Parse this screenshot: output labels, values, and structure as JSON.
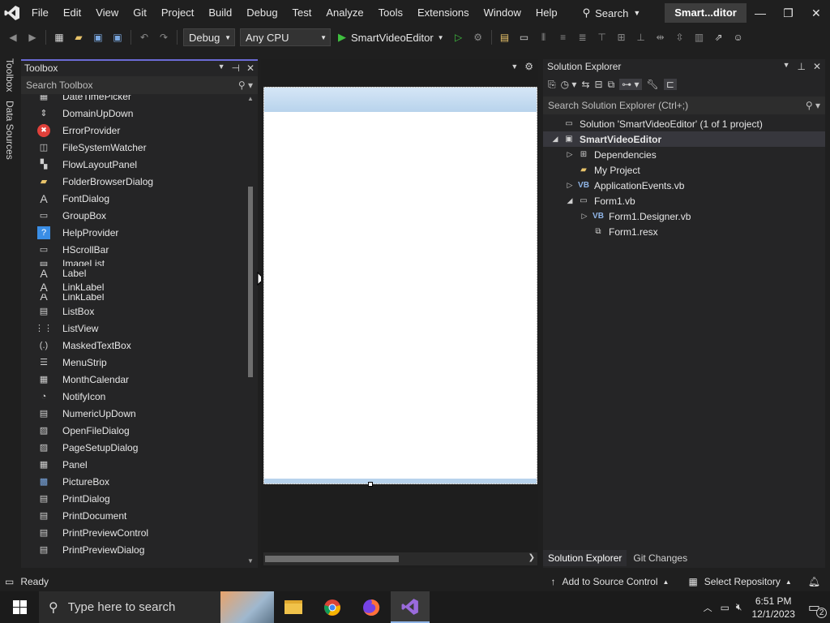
{
  "titlebar": {
    "menu": [
      "File",
      "Edit",
      "View",
      "Git",
      "Project",
      "Build",
      "Debug",
      "Test",
      "Analyze",
      "Tools",
      "Extensions",
      "Window",
      "Help"
    ],
    "search_label": "Search",
    "solution_name": "Smart...ditor"
  },
  "toolbar": {
    "config": "Debug",
    "platform": "Any CPU",
    "start_target": "SmartVideoEditor"
  },
  "left_strip": {
    "tabs": [
      "Toolbox",
      "Data Sources"
    ]
  },
  "toolbox": {
    "title": "Toolbox",
    "search_placeholder": "Search Toolbox",
    "items": [
      {
        "label": "DateTimePicker",
        "icon": "calendar-icon"
      },
      {
        "label": "DomainUpDown",
        "icon": "updown-icon"
      },
      {
        "label": "ErrorProvider",
        "icon": "error-icon"
      },
      {
        "label": "FileSystemWatcher",
        "icon": "watcher-icon"
      },
      {
        "label": "FlowLayoutPanel",
        "icon": "flowlayout-icon"
      },
      {
        "label": "FolderBrowserDialog",
        "icon": "folder-icon"
      },
      {
        "label": "FontDialog",
        "icon": "font-icon"
      },
      {
        "label": "GroupBox",
        "icon": "groupbox-icon"
      },
      {
        "label": "HelpProvider",
        "icon": "help-icon"
      },
      {
        "label": "HScrollBar",
        "icon": "hscroll-icon"
      },
      {
        "label": "ImageList",
        "icon": "imagelist-icon"
      },
      {
        "label": "Label",
        "icon": "label-icon"
      },
      {
        "label": "LinkLabel",
        "icon": "linklabel-icon"
      },
      {
        "label": "LinkLabel",
        "icon": "linklabel-icon"
      },
      {
        "label": "ListBox",
        "icon": "listbox-icon"
      },
      {
        "label": "ListView",
        "icon": "listview-icon"
      },
      {
        "label": "MaskedTextBox",
        "icon": "masked-icon"
      },
      {
        "label": "MenuStrip",
        "icon": "menustrip-icon"
      },
      {
        "label": "MonthCalendar",
        "icon": "monthcalendar-icon"
      },
      {
        "label": "NotifyIcon",
        "icon": "notify-icon"
      },
      {
        "label": "NumericUpDown",
        "icon": "numeric-icon"
      },
      {
        "label": "OpenFileDialog",
        "icon": "openfile-icon"
      },
      {
        "label": "PageSetupDialog",
        "icon": "pagesetup-icon"
      },
      {
        "label": "Panel",
        "icon": "panel-icon"
      },
      {
        "label": "PictureBox",
        "icon": "picture-icon"
      },
      {
        "label": "PrintDialog",
        "icon": "print-icon"
      },
      {
        "label": "PrintDocument",
        "icon": "printdoc-icon"
      },
      {
        "label": "PrintPreviewControl",
        "icon": "preview-icon"
      },
      {
        "label": "PrintPreviewDialog",
        "icon": "previewdialog-icon"
      }
    ]
  },
  "solution_explorer": {
    "title": "Solution Explorer",
    "search_placeholder": "Search Solution Explorer (Ctrl+;)",
    "tree": [
      {
        "label": "Solution 'SmartVideoEditor' (1 of 1 project)",
        "indent": 0,
        "arrow": "",
        "icon": "solution-icon"
      },
      {
        "label": "SmartVideoEditor",
        "indent": 0,
        "arrow": "◢",
        "icon": "vb-project-icon",
        "selected": true
      },
      {
        "label": "Dependencies",
        "indent": 1,
        "arrow": "▷",
        "icon": "dependencies-icon"
      },
      {
        "label": "My Project",
        "indent": 1,
        "arrow": "",
        "icon": "wrench-icon"
      },
      {
        "label": "ApplicationEvents.vb",
        "indent": 1,
        "arrow": "▷",
        "icon": "vb-file-icon"
      },
      {
        "label": "Form1.vb",
        "indent": 1,
        "arrow": "◢",
        "icon": "form-icon"
      },
      {
        "label": "Form1.Designer.vb",
        "indent": 2,
        "arrow": "▷",
        "icon": "vb-file-icon"
      },
      {
        "label": "Form1.resx",
        "indent": 2,
        "arrow": "",
        "icon": "resx-icon"
      }
    ],
    "tabs": [
      "Solution Explorer",
      "Git Changes"
    ]
  },
  "statusbar": {
    "status": "Ready",
    "source_control": "Add to Source Control",
    "repository": "Select Repository"
  },
  "taskbar": {
    "search_placeholder": "Type here to search",
    "time": "6:51 PM",
    "date": "12/1/2023",
    "notification_count": "2"
  },
  "colors": {
    "accent": "#6b6bd6",
    "selected_row": "#37373d",
    "panel_bg": "#252526"
  }
}
